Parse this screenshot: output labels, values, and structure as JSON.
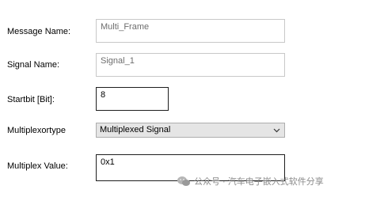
{
  "form": {
    "message_name": {
      "label": "Message Name:",
      "value": "Multi_Frame"
    },
    "signal_name": {
      "label": "Signal Name:",
      "value": "Signal_1"
    },
    "startbit": {
      "label": "Startbit [Bit]:",
      "value": "8"
    },
    "multiplexortype": {
      "label": "Multiplexortype",
      "selected": "Multiplexed Signal",
      "arrow_icon": "chevron-down-icon"
    },
    "multiplex_value": {
      "label": "Multiplex Value:",
      "value": "0x1"
    }
  },
  "watermark": {
    "text": "公众号 · 汽车电子嵌入式软件分享",
    "icon": "wechat-logo-icon"
  }
}
